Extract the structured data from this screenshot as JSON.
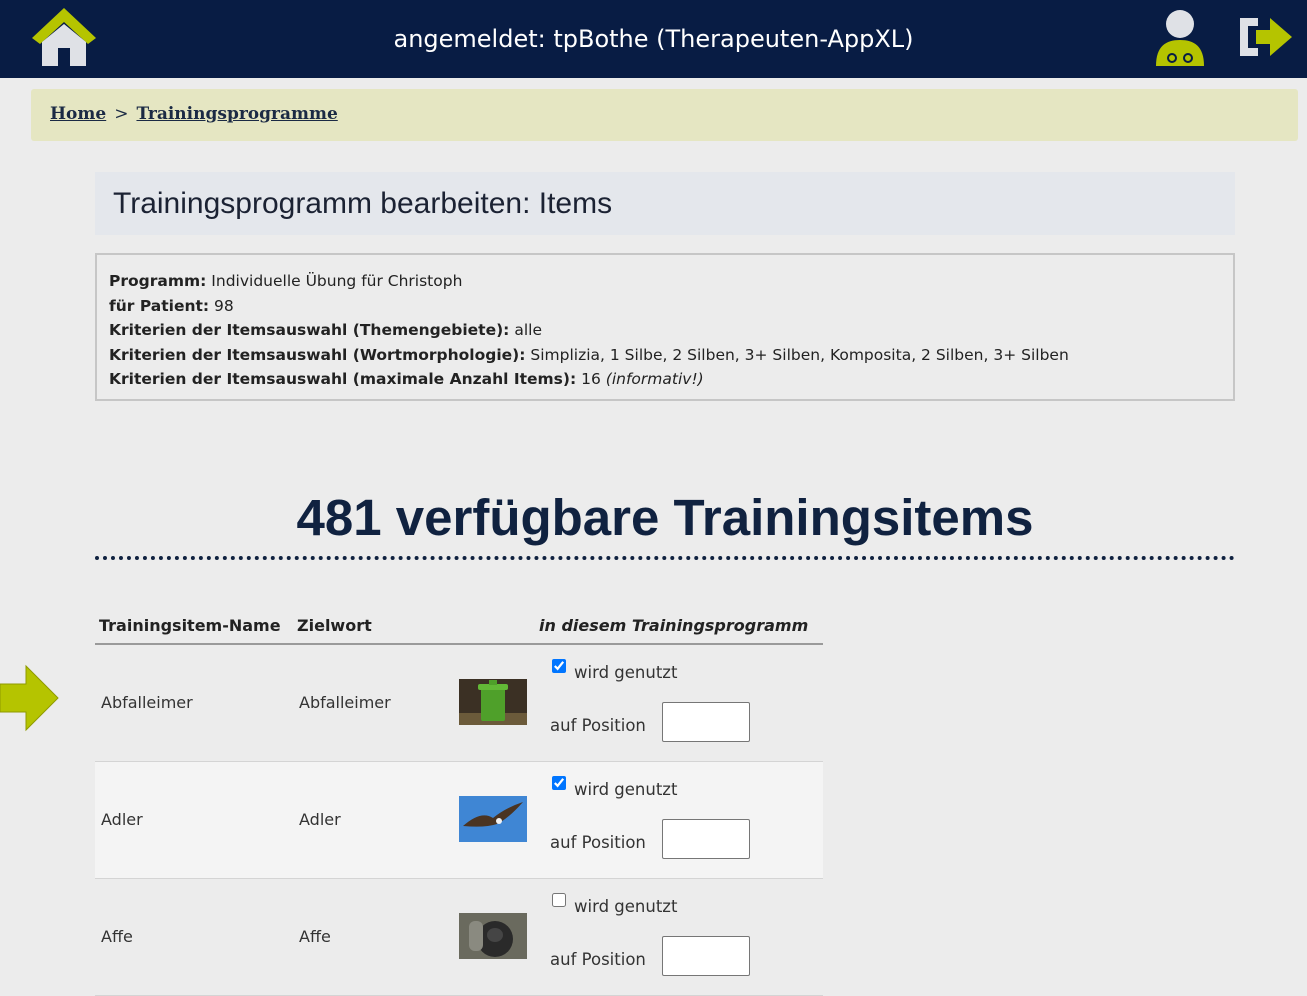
{
  "header": {
    "title": "angemeldet: tpBothe (Therapeuten-AppXL)",
    "icons": [
      "home-icon",
      "user-doctor-icon",
      "logout-icon"
    ]
  },
  "breadcrumb": {
    "home": "Home",
    "separator": ">",
    "current": "Trainingsprogramme"
  },
  "page_title": "Trainingsprogramm bearbeiten: Items",
  "info": {
    "programm_label": "Programm:",
    "programm_value": "Individuelle Übung für Christoph",
    "patient_label": "für Patient:",
    "patient_value": "98",
    "themen_label": "Kriterien der Itemsauswahl (Themengebiete):",
    "themen_value": "alle",
    "morph_label": "Kriterien der Itemsauswahl (Wortmorphologie):",
    "morph_value": "Simplizia, 1 Silbe, 2 Silben, 3+ Silben, Komposita, 2 Silben, 3+ Silben",
    "max_label": "Kriterien der Itemsauswahl (maximale Anzahl Items):",
    "max_value": "16",
    "max_note": "(informativ!)"
  },
  "available_heading": "481 verfügbare Trainingsitems",
  "table": {
    "columns": [
      "Trainingsitem-Name",
      "Zielwort",
      "in diesem Trainingsprogramm"
    ],
    "used_label": "wird genutzt",
    "position_label": "auf Position",
    "rows": [
      {
        "name": "Abfalleimer",
        "target": "Abfalleimer",
        "image": "green-trash-bin",
        "used": true,
        "position": ""
      },
      {
        "name": "Adler",
        "target": "Adler",
        "image": "eagle-flying",
        "used": true,
        "position": ""
      },
      {
        "name": "Affe",
        "target": "Affe",
        "image": "gorilla",
        "used": false,
        "position": ""
      }
    ]
  },
  "colors": {
    "topbar": "#081c44",
    "accent_green": "#b5c400",
    "breadcrumb_bg": "#e5e6c2",
    "heading": "#102240"
  }
}
